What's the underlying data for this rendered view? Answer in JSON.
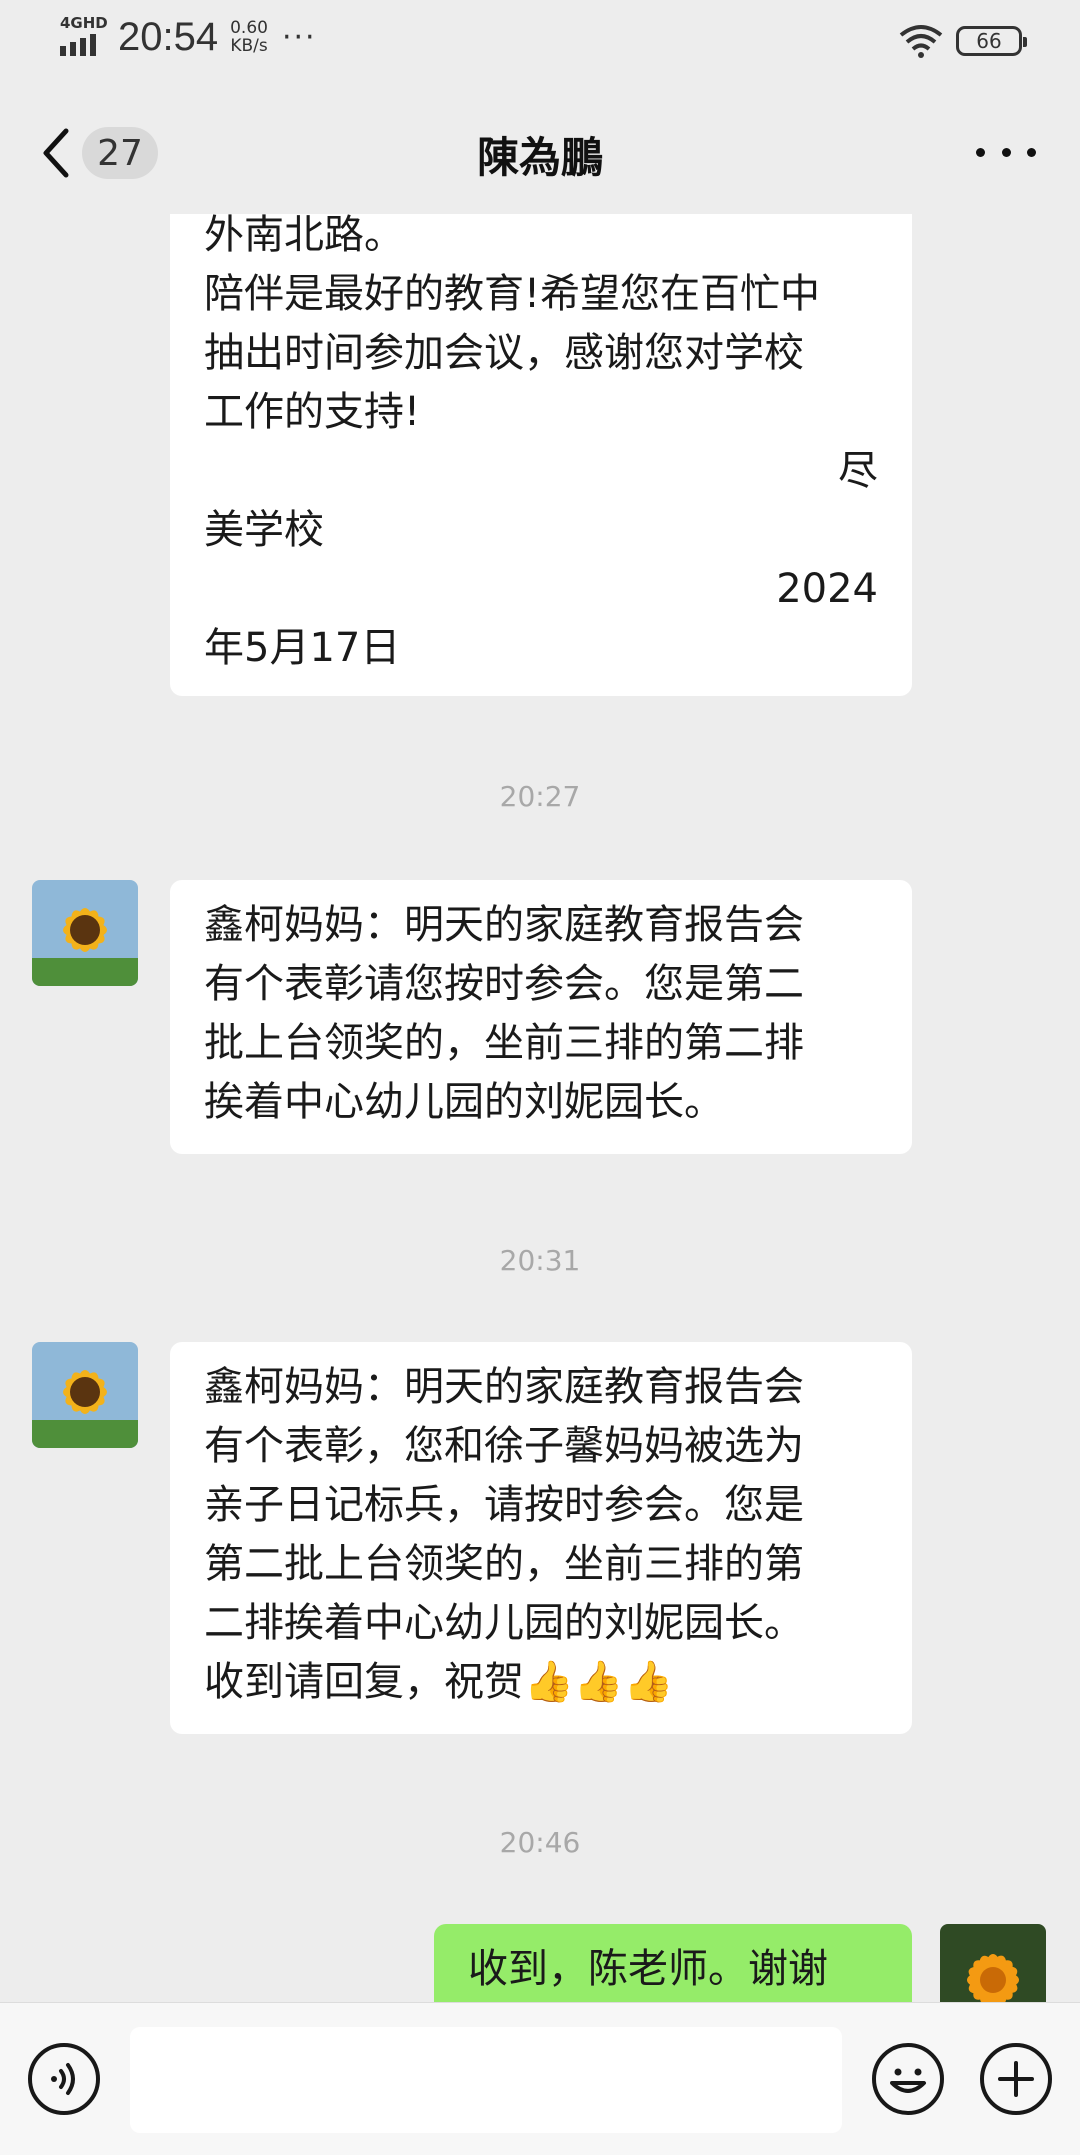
{
  "status_bar": {
    "network": "4GHD",
    "time": "20:54",
    "speed_value": "0.60",
    "speed_unit": "KB/s",
    "more": "···",
    "battery": "66"
  },
  "nav": {
    "unread_count": "27",
    "title": "陳為鵬"
  },
  "messages": [
    {
      "type": "received",
      "lines": [
        {
          "text": "外南北路。",
          "align": "left"
        },
        {
          "text": "陪伴是最好的教育!希望您在百忙中",
          "align": "left"
        },
        {
          "text": "抽出时间参加会议，感谢您对学校",
          "align": "left"
        },
        {
          "text": "工作的支持!",
          "align": "left"
        },
        {
          "text": "尽",
          "align": "right"
        },
        {
          "text": "美学校",
          "align": "left"
        },
        {
          "text": "2024",
          "align": "right"
        },
        {
          "text": "年5月17日",
          "align": "left"
        }
      ]
    },
    {
      "type": "time",
      "text": "20:27"
    },
    {
      "type": "received",
      "lines": [
        {
          "text": "鑫柯妈妈：明天的家庭教育报告会",
          "align": "left"
        },
        {
          "text": "有个表彰请您按时参会。您是第二",
          "align": "left"
        },
        {
          "text": "批上台领奖的，坐前三排的第二排",
          "align": "left"
        },
        {
          "text": "挨着中心幼儿园的刘妮园长。",
          "align": "left"
        }
      ]
    },
    {
      "type": "time",
      "text": "20:31"
    },
    {
      "type": "received",
      "lines": [
        {
          "text": "鑫柯妈妈：明天的家庭教育报告会",
          "align": "left"
        },
        {
          "text": "有个表彰，您和徐子馨妈妈被选为",
          "align": "left"
        },
        {
          "text": "亲子日记标兵，请按时参会。您是",
          "align": "left"
        },
        {
          "text": "第二批上台领奖的，坐前三排的第",
          "align": "left"
        },
        {
          "text": "二排挨着中心幼儿园的刘妮园长。",
          "align": "left"
        },
        {
          "text": "收到请回复，祝贺👍👍👍",
          "align": "left"
        }
      ]
    },
    {
      "type": "time",
      "text": "20:46"
    },
    {
      "type": "sent",
      "lines": [
        {
          "text": "收到，陈老师。谢谢",
          "align": "left"
        }
      ]
    }
  ],
  "input": {
    "value": "",
    "placeholder": ""
  },
  "colors": {
    "background": "#ededed",
    "received_bubble": "#ffffff",
    "sent_bubble": "#95ec69",
    "timestamp": "#a8a8a8"
  },
  "icons": {
    "back": "chevron-left-icon",
    "more": "ellipsis-icon",
    "voice": "voice-icon",
    "emoji": "emoji-icon",
    "add": "plus-icon",
    "wifi": "wifi-icon",
    "signal": "signal-icon",
    "battery": "battery-icon"
  }
}
